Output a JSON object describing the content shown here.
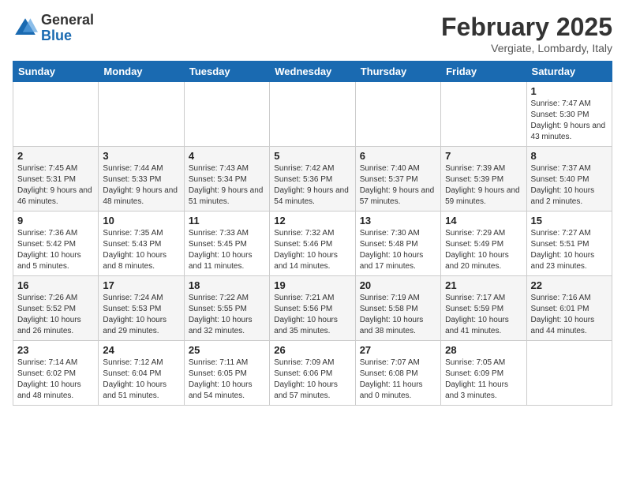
{
  "logo": {
    "general": "General",
    "blue": "Blue"
  },
  "title": {
    "month": "February 2025",
    "location": "Vergiate, Lombardy, Italy"
  },
  "weekdays": [
    "Sunday",
    "Monday",
    "Tuesday",
    "Wednesday",
    "Thursday",
    "Friday",
    "Saturday"
  ],
  "weeks": [
    [
      {
        "day": "",
        "info": ""
      },
      {
        "day": "",
        "info": ""
      },
      {
        "day": "",
        "info": ""
      },
      {
        "day": "",
        "info": ""
      },
      {
        "day": "",
        "info": ""
      },
      {
        "day": "",
        "info": ""
      },
      {
        "day": "1",
        "info": "Sunrise: 7:47 AM\nSunset: 5:30 PM\nDaylight: 9 hours and 43 minutes."
      }
    ],
    [
      {
        "day": "2",
        "info": "Sunrise: 7:45 AM\nSunset: 5:31 PM\nDaylight: 9 hours and 46 minutes."
      },
      {
        "day": "3",
        "info": "Sunrise: 7:44 AM\nSunset: 5:33 PM\nDaylight: 9 hours and 48 minutes."
      },
      {
        "day": "4",
        "info": "Sunrise: 7:43 AM\nSunset: 5:34 PM\nDaylight: 9 hours and 51 minutes."
      },
      {
        "day": "5",
        "info": "Sunrise: 7:42 AM\nSunset: 5:36 PM\nDaylight: 9 hours and 54 minutes."
      },
      {
        "day": "6",
        "info": "Sunrise: 7:40 AM\nSunset: 5:37 PM\nDaylight: 9 hours and 57 minutes."
      },
      {
        "day": "7",
        "info": "Sunrise: 7:39 AM\nSunset: 5:39 PM\nDaylight: 9 hours and 59 minutes."
      },
      {
        "day": "8",
        "info": "Sunrise: 7:37 AM\nSunset: 5:40 PM\nDaylight: 10 hours and 2 minutes."
      }
    ],
    [
      {
        "day": "9",
        "info": "Sunrise: 7:36 AM\nSunset: 5:42 PM\nDaylight: 10 hours and 5 minutes."
      },
      {
        "day": "10",
        "info": "Sunrise: 7:35 AM\nSunset: 5:43 PM\nDaylight: 10 hours and 8 minutes."
      },
      {
        "day": "11",
        "info": "Sunrise: 7:33 AM\nSunset: 5:45 PM\nDaylight: 10 hours and 11 minutes."
      },
      {
        "day": "12",
        "info": "Sunrise: 7:32 AM\nSunset: 5:46 PM\nDaylight: 10 hours and 14 minutes."
      },
      {
        "day": "13",
        "info": "Sunrise: 7:30 AM\nSunset: 5:48 PM\nDaylight: 10 hours and 17 minutes."
      },
      {
        "day": "14",
        "info": "Sunrise: 7:29 AM\nSunset: 5:49 PM\nDaylight: 10 hours and 20 minutes."
      },
      {
        "day": "15",
        "info": "Sunrise: 7:27 AM\nSunset: 5:51 PM\nDaylight: 10 hours and 23 minutes."
      }
    ],
    [
      {
        "day": "16",
        "info": "Sunrise: 7:26 AM\nSunset: 5:52 PM\nDaylight: 10 hours and 26 minutes."
      },
      {
        "day": "17",
        "info": "Sunrise: 7:24 AM\nSunset: 5:53 PM\nDaylight: 10 hours and 29 minutes."
      },
      {
        "day": "18",
        "info": "Sunrise: 7:22 AM\nSunset: 5:55 PM\nDaylight: 10 hours and 32 minutes."
      },
      {
        "day": "19",
        "info": "Sunrise: 7:21 AM\nSunset: 5:56 PM\nDaylight: 10 hours and 35 minutes."
      },
      {
        "day": "20",
        "info": "Sunrise: 7:19 AM\nSunset: 5:58 PM\nDaylight: 10 hours and 38 minutes."
      },
      {
        "day": "21",
        "info": "Sunrise: 7:17 AM\nSunset: 5:59 PM\nDaylight: 10 hours and 41 minutes."
      },
      {
        "day": "22",
        "info": "Sunrise: 7:16 AM\nSunset: 6:01 PM\nDaylight: 10 hours and 44 minutes."
      }
    ],
    [
      {
        "day": "23",
        "info": "Sunrise: 7:14 AM\nSunset: 6:02 PM\nDaylight: 10 hours and 48 minutes."
      },
      {
        "day": "24",
        "info": "Sunrise: 7:12 AM\nSunset: 6:04 PM\nDaylight: 10 hours and 51 minutes."
      },
      {
        "day": "25",
        "info": "Sunrise: 7:11 AM\nSunset: 6:05 PM\nDaylight: 10 hours and 54 minutes."
      },
      {
        "day": "26",
        "info": "Sunrise: 7:09 AM\nSunset: 6:06 PM\nDaylight: 10 hours and 57 minutes."
      },
      {
        "day": "27",
        "info": "Sunrise: 7:07 AM\nSunset: 6:08 PM\nDaylight: 11 hours and 0 minutes."
      },
      {
        "day": "28",
        "info": "Sunrise: 7:05 AM\nSunset: 6:09 PM\nDaylight: 11 hours and 3 minutes."
      },
      {
        "day": "",
        "info": ""
      }
    ]
  ]
}
